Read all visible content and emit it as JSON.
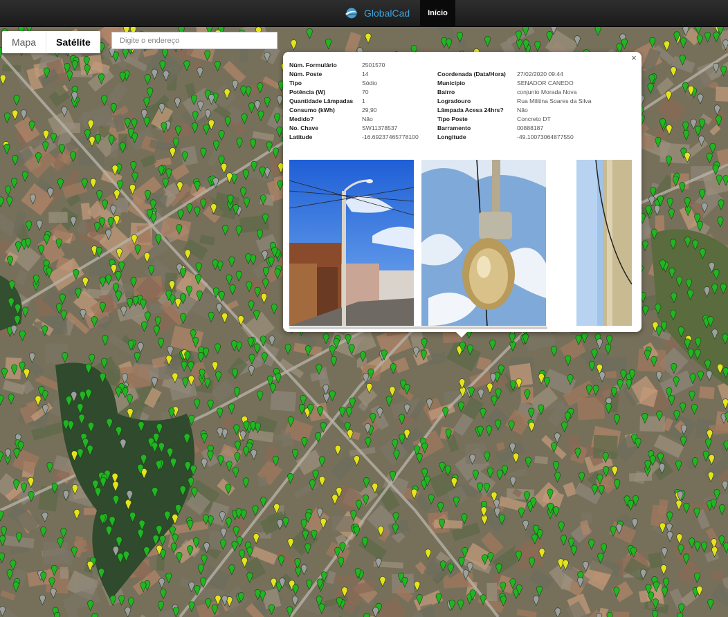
{
  "navbar": {
    "brand": "GlobalCad",
    "nav_inicio": "Início",
    "logo_icon": "globe-swoosh-icon"
  },
  "map_type": {
    "mapa": "Mapa",
    "satelite": "Satélite",
    "selected": "Satélite"
  },
  "search": {
    "placeholder": "Digite o endereço",
    "value": ""
  },
  "marker_colors": {
    "green": "#21b521",
    "yellow": "#e6e21c",
    "gray": "#9e9e9e"
  },
  "infowindow": {
    "close_icon": "close-icon",
    "left": [
      {
        "label": "Núm. Formulário",
        "value": "2501570"
      },
      {
        "label": "Núm. Poste",
        "value": "14"
      },
      {
        "label": "Tipo",
        "value": "Sódio"
      },
      {
        "label": "Potência (W)",
        "value": "70"
      },
      {
        "label": "Quantidade Lâmpadas",
        "value": "1"
      },
      {
        "label": "Consumo (kWh)",
        "value": "29,90"
      },
      {
        "label": "Medido?",
        "value": "Não"
      },
      {
        "label": "No. Chave",
        "value": "SW11378537"
      },
      {
        "label": "Latitude",
        "value": "-16.69237465778100"
      }
    ],
    "right": [
      {
        "label": "Coordenada (Data/Hora)",
        "value": "27/02/2020 09:44"
      },
      {
        "label": "Município",
        "value": "SENADOR CANEDO"
      },
      {
        "label": "Bairro",
        "value": "conjunto Morada Nova"
      },
      {
        "label": "Logradouro",
        "value": "Rua Militina Soares da Silva"
      },
      {
        "label": "Lâmpada Acesa 24hrs?",
        "value": "Não"
      },
      {
        "label": "Tipo Poste",
        "value": "Concreto DT"
      },
      {
        "label": "Barramento",
        "value": "00888187"
      },
      {
        "label": "Longitude",
        "value": "-49.10073064877550"
      }
    ],
    "photos": [
      "photo-pole-street",
      "photo-lamp-fixture",
      "photo-pole-closeup"
    ]
  }
}
